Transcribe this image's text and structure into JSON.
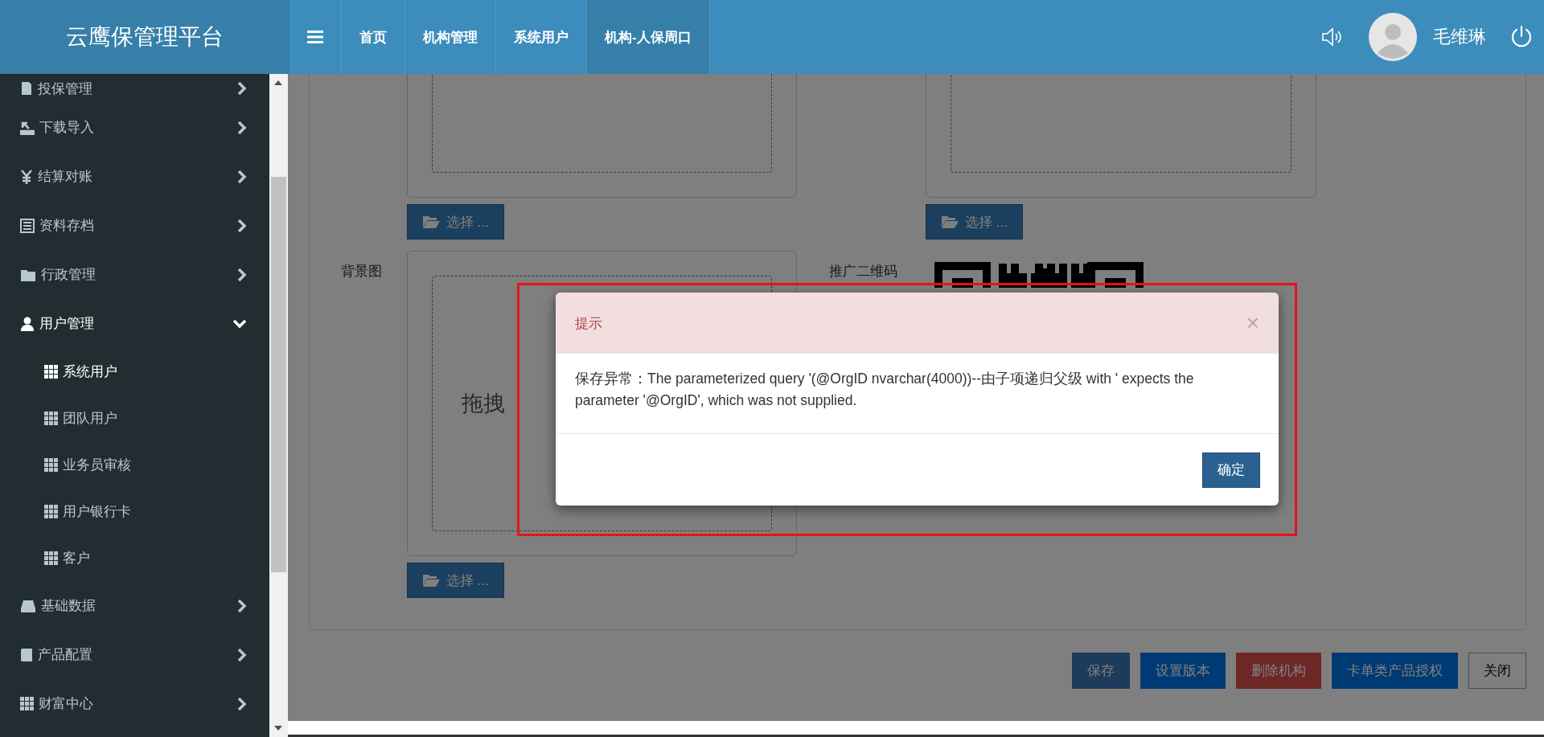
{
  "header": {
    "title": "云鹰保管理平台",
    "nav": [
      {
        "label": "首页",
        "selected": false
      },
      {
        "label": "机构管理",
        "selected": false
      },
      {
        "label": "系统用户",
        "selected": false
      },
      {
        "label": "机构-人保周口",
        "selected": true
      }
    ],
    "user": {
      "name": "毛维琳"
    }
  },
  "sidebar": {
    "items": [
      {
        "label": "投保管理",
        "expanded": false
      },
      {
        "label": "下载导入",
        "expanded": false
      },
      {
        "label": "结算对账",
        "expanded": false
      },
      {
        "label": "资料存档",
        "expanded": false
      },
      {
        "label": "行政管理",
        "expanded": false
      },
      {
        "label": "用户管理",
        "expanded": true,
        "children": [
          {
            "label": "系统用户",
            "selected": true
          },
          {
            "label": "团队用户",
            "selected": false
          },
          {
            "label": "业务员审核",
            "selected": false
          },
          {
            "label": "用户银行卡",
            "selected": false
          },
          {
            "label": "客户",
            "selected": false
          }
        ]
      },
      {
        "label": "基础数据",
        "expanded": false
      },
      {
        "label": "产品配置",
        "expanded": false
      },
      {
        "label": "财富中心",
        "expanded": false
      }
    ]
  },
  "form": {
    "fields": [
      {
        "kind": "upload",
        "button": "选择 ..."
      },
      {
        "kind": "upload",
        "button": "选择 ..."
      },
      {
        "kind": "upload",
        "label": "背景图",
        "drop_text": "拖拽",
        "button": "选择 ..."
      },
      {
        "kind": "qr",
        "label": "推广二维码"
      }
    ]
  },
  "actions": [
    {
      "label": "保存",
      "kind": "primary"
    },
    {
      "label": "设置版本",
      "kind": "info"
    },
    {
      "label": "删除机构",
      "kind": "danger"
    },
    {
      "label": "卡单类产品授权",
      "kind": "info"
    },
    {
      "label": "关闭",
      "kind": "default"
    }
  ],
  "dialog": {
    "title": "提示",
    "close": "×",
    "message": "保存异常：The parameterized query '(@OrgID nvarchar(4000))--由子项递归父级 with ' expects the parameter '@OrgID', which was not supplied.",
    "button": "确定",
    "highlighted": true
  }
}
